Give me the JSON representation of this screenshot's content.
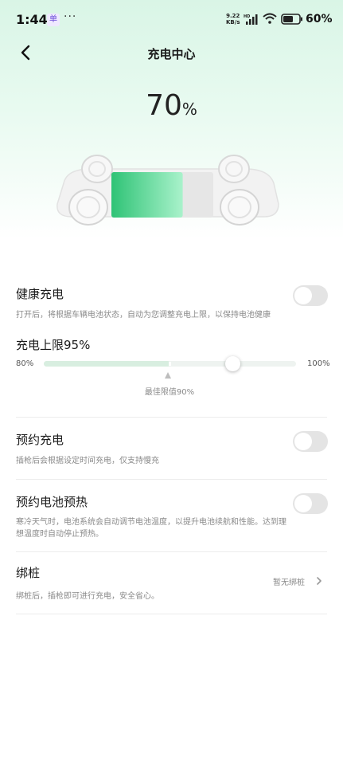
{
  "status_bar": {
    "time": "1:44",
    "notification_glyph": "单",
    "more": "···",
    "net_speed_value": "9.22",
    "net_speed_unit": "KB/s",
    "net_type": "HD",
    "battery_percent": "60%",
    "battery_level": 0.6
  },
  "nav": {
    "title": "充电中心"
  },
  "hero": {
    "soc_value": "70",
    "soc_unit": "%",
    "charge_level": 0.7,
    "accent_color": "#3ccf84"
  },
  "health_charge": {
    "title": "健康充电",
    "description": "打开后，将根据车辆电池状态，自动为您调整充电上限，以保持电池健康",
    "enabled": false
  },
  "charge_limit": {
    "title": "充电上限95%",
    "min_label": "80%",
    "max_label": "100%",
    "min_value": 80,
    "max_value": 100,
    "value": 95,
    "best_value": 90,
    "best_label": "最佳限值90%"
  },
  "scheduled_charge": {
    "title": "预约充电",
    "description": "插枪后会根据设定时间充电，仅支持慢充",
    "enabled": false
  },
  "battery_preheat": {
    "title": "预约电池预热",
    "description_line1": "寒冷天气时，电池系统会自动调节电池温度，以提升电池续航和性能。达到理",
    "description_line2": "想温度时自动停止预热。",
    "enabled": false
  },
  "bind_charger": {
    "title": "绑桩",
    "description": "绑桩后，插枪即可进行充电，安全省心。",
    "status": "暂无绑桩"
  }
}
